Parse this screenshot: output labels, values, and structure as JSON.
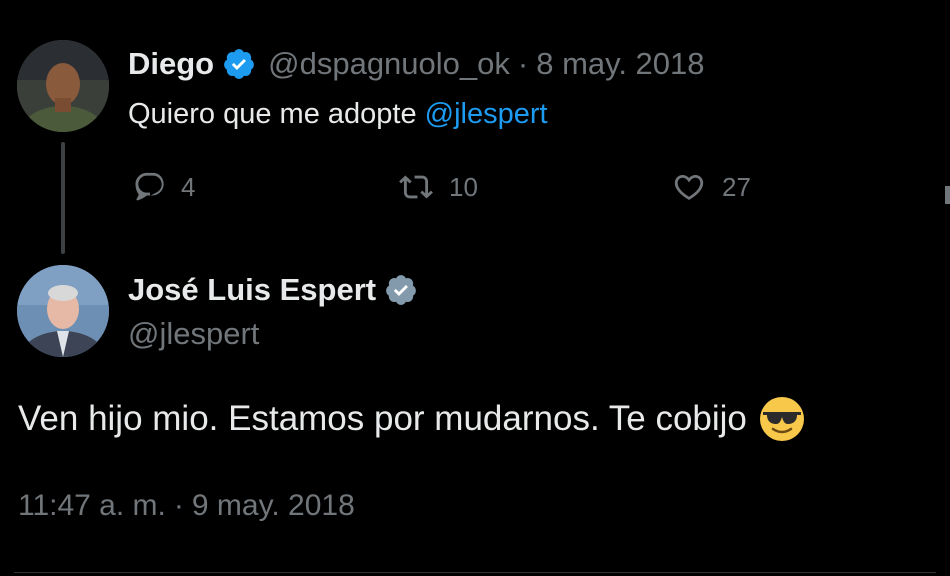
{
  "reply_parent": {
    "display_name": "Diego",
    "handle": "@dspagnuolo_ok",
    "separator": "·",
    "date": "8 may. 2018",
    "text_prefix": "Quiero que me adopte ",
    "mention": "@jlespert",
    "actions": {
      "reply_count": "4",
      "retweet_count": "10",
      "like_count": "27"
    },
    "verified_color": "#1d9bf0"
  },
  "main_tweet": {
    "display_name": "José Luis Espert",
    "handle": "@jlespert",
    "text": "Ven hijo mio. Estamos por mudarnos. Te cobijo",
    "emoji": "smiling-face-with-sunglasses",
    "time": "11:47 a. m.",
    "separator": "·",
    "date": "9 may. 2018",
    "verified_color": "#829aab"
  },
  "colors": {
    "background": "#000000",
    "primary_text": "#e7e9ea",
    "secondary_text": "#71767b",
    "link": "#1d9bf0"
  }
}
